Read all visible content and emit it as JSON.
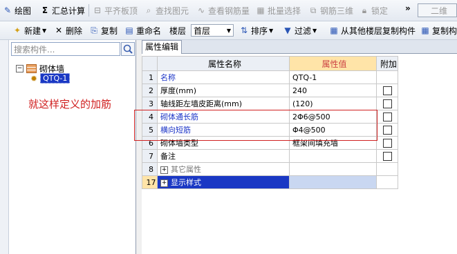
{
  "toolbar1": {
    "items": [
      "绘图",
      "汇总计算",
      "平齐板顶",
      "查找图元",
      "查看钢筋量",
      "批量选择",
      "钢筋三维",
      "锁定"
    ],
    "view_select": "二维"
  },
  "toolbar2": {
    "new": "新建",
    "delete": "删除",
    "copy": "复制",
    "rename": "重命名",
    "floor_label": "楼层",
    "floor_value": "首层",
    "sort": "排序",
    "filter": "过滤",
    "copy_from_floor": "从其他楼层复制构件",
    "copy_component": "复制构"
  },
  "left_panel": {
    "search_placeholder": "搜索构件...",
    "tree_parent": "砌体墙",
    "tree_child": "QTQ-1"
  },
  "annotation": "就这样定义的加筋",
  "tab": "属性编辑",
  "grid": {
    "headers": {
      "name": "属性名称",
      "value": "属性值",
      "extra": "附加"
    },
    "rows": [
      {
        "no": "1",
        "name": "名称",
        "value": "QTQ-1",
        "check": false
      },
      {
        "no": "2",
        "name": "厚度(mm)",
        "value": "240",
        "check": true
      },
      {
        "no": "3",
        "name": "轴线距左墙皮距离(mm)",
        "value": "(120)",
        "check": true
      },
      {
        "no": "4",
        "name": "砌体通长筋",
        "value": "2Φ6@500",
        "check": true
      },
      {
        "no": "5",
        "name": "横向短筋",
        "value": "Φ4@500",
        "check": true
      },
      {
        "no": "6",
        "name": "砌体墙类型",
        "value": "框架间填充墙",
        "check": true
      },
      {
        "no": "7",
        "name": "备注",
        "value": "",
        "check": true
      },
      {
        "no": "8",
        "name": "其它属性",
        "value": "",
        "check": false
      },
      {
        "no": "17",
        "name": "显示样式",
        "value": "",
        "check": false
      }
    ]
  }
}
